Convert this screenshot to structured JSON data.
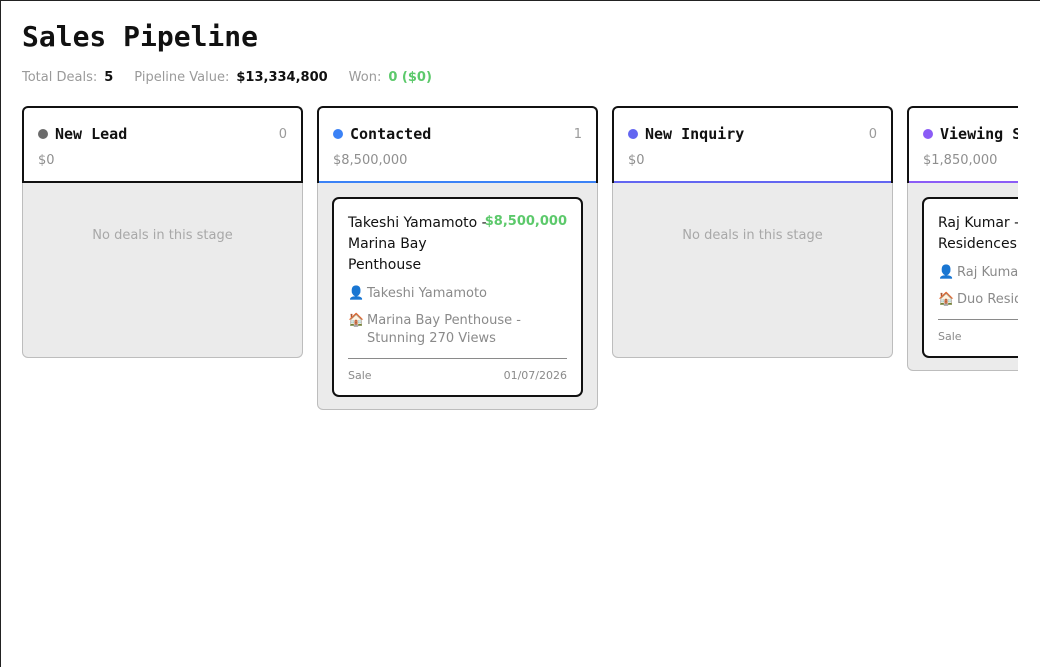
{
  "page": {
    "title": "Sales Pipeline"
  },
  "stats": {
    "total_deals_label": "Total Deals:",
    "total_deals_value": "5",
    "pipeline_value_label": "Pipeline Value:",
    "pipeline_value_value": "$13,334,800",
    "won_label": "Won:",
    "won_value": "0 ($0)"
  },
  "colors": {
    "won_green": "#5cc96b",
    "new_lead": "#6b6b6b",
    "contacted": "#3b82f6",
    "new_inquiry": "#6366f1",
    "viewing": "#8b5cf6"
  },
  "columns": [
    {
      "title": "New Lead",
      "count": "0",
      "total": "$0",
      "empty_text": "No deals in this stage",
      "cards": []
    },
    {
      "title": "Contacted",
      "count": "1",
      "total": "$8,500,000",
      "empty_text": "",
      "cards": [
        {
          "title": "Takeshi Yamamoto - Marina Bay Penthouse",
          "amount": "$8,500,000",
          "contact_icon": "person-icon",
          "contact": "Takeshi Yamamoto",
          "property_icon": "house-icon",
          "property": "Marina Bay Penthouse - Stunning 270 Views",
          "type": "Sale",
          "date": "01/07/2026"
        }
      ]
    },
    {
      "title": "New Inquiry",
      "count": "0",
      "total": "$0",
      "empty_text": "No deals in this stage",
      "cards": []
    },
    {
      "title": "Viewing S",
      "count": "",
      "total": "$1,850,000",
      "empty_text": "",
      "cards": [
        {
          "title": "Raj Kumar - Residences",
          "amount": "",
          "contact_icon": "person-icon",
          "contact": "Raj Kumar",
          "property_icon": "house-icon",
          "property": "Duo Resid",
          "type": "Sale",
          "date": ""
        }
      ]
    }
  ]
}
